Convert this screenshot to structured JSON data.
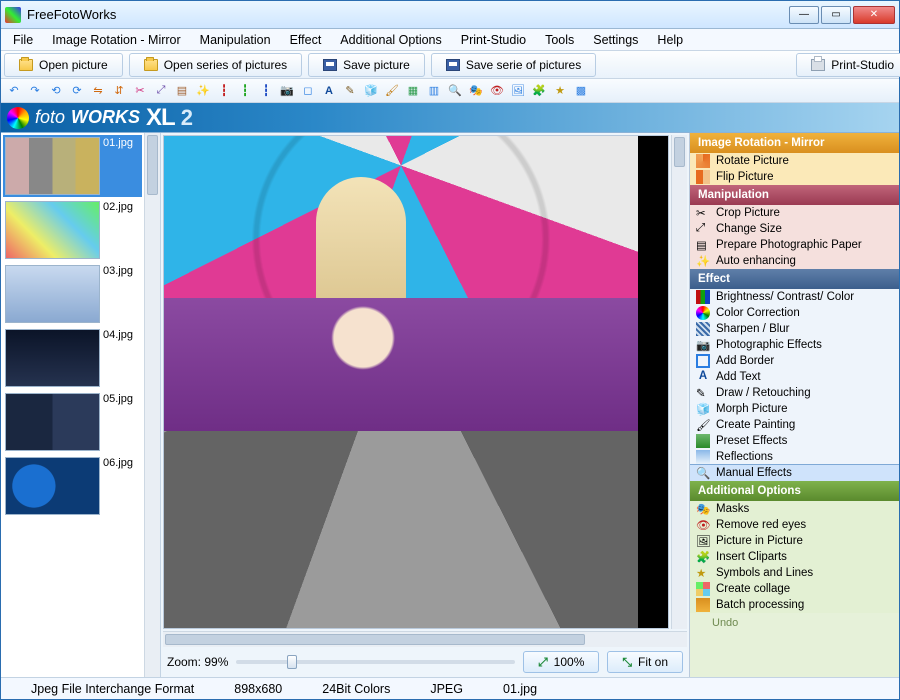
{
  "app": {
    "title": "FreeFotoWorks"
  },
  "menu": [
    "File",
    "Image Rotation - Mirror",
    "Manipulation",
    "Effect",
    "Additional Options",
    "Print-Studio",
    "Tools",
    "Settings",
    "Help"
  ],
  "toolbar": {
    "open_picture": "Open picture",
    "open_series": "Open series of pictures",
    "save_picture": "Save picture",
    "save_series": "Save serie of pictures",
    "print_studio": "Print-Studio"
  },
  "brand": {
    "foto": "foto",
    "works": "WORKS",
    "xl": "XL",
    "ver": "2"
  },
  "thumbs": [
    {
      "name": "01.jpg"
    },
    {
      "name": "02.jpg"
    },
    {
      "name": "03.jpg"
    },
    {
      "name": "04.jpg"
    },
    {
      "name": "05.jpg"
    },
    {
      "name": "06.jpg"
    }
  ],
  "zoom": {
    "label": "Zoom: 99%",
    "btn100": "100%",
    "btnFit": "Fit on"
  },
  "panel": {
    "rot_head": "Image Rotation - Mirror",
    "rot": [
      "Rotate Picture",
      "Flip Picture"
    ],
    "man_head": "Manipulation",
    "man": [
      "Crop Picture",
      "Change Size",
      "Prepare Photographic Paper",
      "Auto enhancing"
    ],
    "eff_head": "Effect",
    "eff": [
      "Brightness/ Contrast/ Color",
      "Color Correction",
      "Sharpen / Blur",
      "Photographic Effects",
      "Add Border",
      "Add Text",
      "Draw / Retouching",
      "Morph Picture",
      "Create Painting",
      "Preset Effects",
      "Reflections",
      "Manual Effects"
    ],
    "add_head": "Additional Options",
    "add": [
      "Masks",
      "Remove red eyes",
      "Picture in Picture",
      "Insert Cliparts",
      "Symbols and Lines",
      "Create collage",
      "Batch processing"
    ],
    "undo": "Undo"
  },
  "status": {
    "format": "Jpeg File Interchange Format",
    "dims": "898x680",
    "depth": "24Bit Colors",
    "type": "JPEG",
    "file": "01.jpg"
  },
  "colors": {
    "accent": "#2b88c8"
  }
}
